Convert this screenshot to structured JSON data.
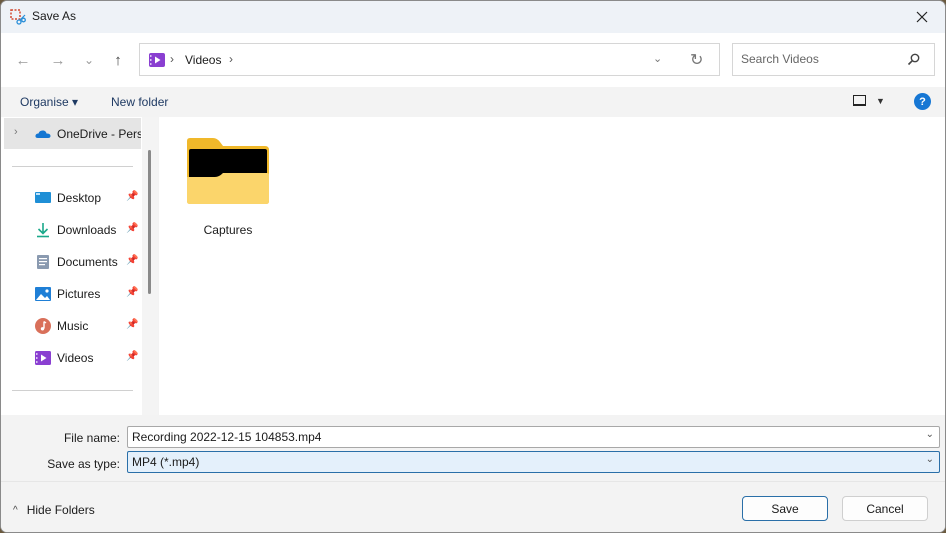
{
  "window": {
    "title": "Save As",
    "close_icon": "close-icon"
  },
  "nav": {
    "back_icon": "←",
    "forward_icon": "→",
    "recent_icon": "⌄",
    "up_icon": "↑",
    "breadcrumb": [
      "Videos"
    ],
    "breadcrumb_sep": "›",
    "address_dropdown_icon": "⌄",
    "refresh_icon": "↻",
    "search_placeholder": "Search Videos"
  },
  "commands": {
    "organise": "Organise ▾",
    "new_folder": "New folder",
    "view_dropdown": "▼",
    "help": "?"
  },
  "sidebar": {
    "expanded_item": {
      "label": "OneDrive - Perso",
      "chevron": "›"
    },
    "items": [
      {
        "label": "Desktop",
        "icon": "desktop-icon",
        "pinned": true
      },
      {
        "label": "Downloads",
        "icon": "downloads-icon",
        "pinned": true
      },
      {
        "label": "Documents",
        "icon": "documents-icon",
        "pinned": true
      },
      {
        "label": "Pictures",
        "icon": "pictures-icon",
        "pinned": true
      },
      {
        "label": "Music",
        "icon": "music-icon",
        "pinned": true
      },
      {
        "label": "Videos",
        "icon": "videos-icon",
        "pinned": true
      }
    ],
    "pin_glyph": "📌"
  },
  "content": {
    "items": [
      {
        "name": "Captures",
        "type": "folder"
      }
    ]
  },
  "form": {
    "file_name_label": "File name:",
    "file_name_value": "Recording 2022-12-15 104853.mp4",
    "save_type_label": "Save as type:",
    "save_type_value": "MP4 (*.mp4)",
    "dropdown_chevron": "⌄"
  },
  "footer": {
    "hide_folders": "Hide Folders",
    "hide_chevron": "^",
    "save": "Save",
    "cancel": "Cancel"
  },
  "colors": {
    "accent": "#2a6fa8",
    "help_blue": "#1677d4",
    "videos_purple": "#8a3fd1",
    "folder_yellow": "#f7c948"
  }
}
